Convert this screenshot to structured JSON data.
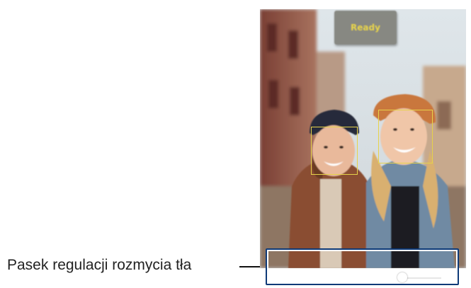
{
  "callout": {
    "label": "Pasek regulacji rozmycia tła"
  },
  "photo": {
    "status_badge": "Ready"
  },
  "blur_slider": {
    "level": 0.74
  },
  "colors": {
    "face_box": "#e6d24a",
    "highlight_border": "#0e3a78",
    "callout_text": "#222222"
  }
}
